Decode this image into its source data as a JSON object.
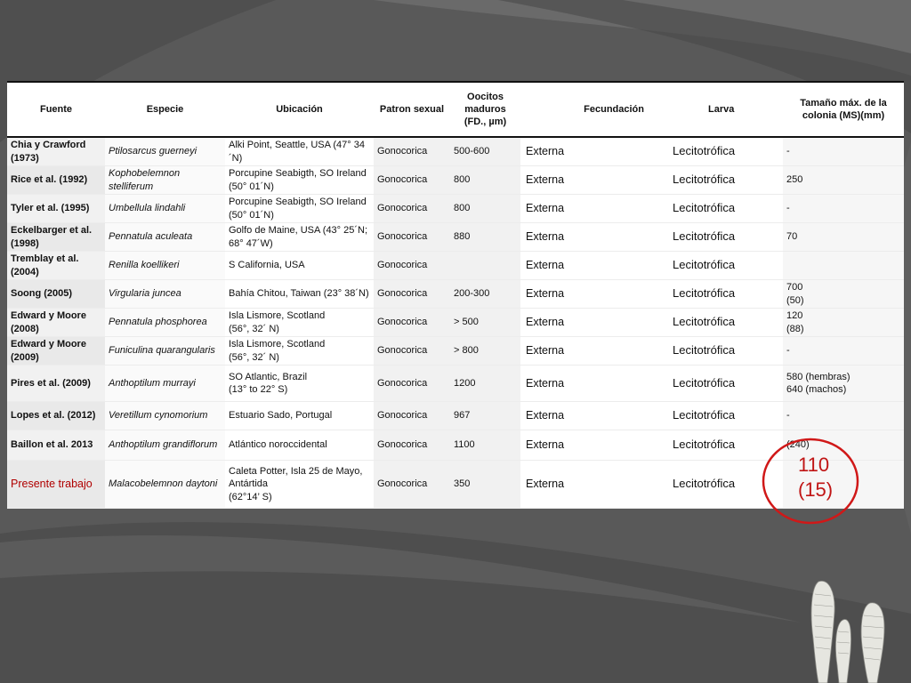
{
  "table": {
    "headers": {
      "fuente": "Fuente",
      "especie": "Especie",
      "ubicacion": "Ubicación",
      "patron": "Patron sexual",
      "oocitos": "Oocitos maduros (FD., µm)",
      "fecundacion": "Fecundación",
      "larva": "Larva",
      "tamano": "Tamaño máx. de la colonia (MS)(mm)"
    },
    "rows": [
      {
        "fuente": "Chia y Crawford (1973)",
        "especie": "Ptilosarcus guerneyi",
        "ubicacion": "Alki Point, Seattle, USA (47° 34´N)",
        "patron": "Gonocorica",
        "oocitos": "500-600",
        "fecundacion": "Externa",
        "larva": "Lecitotrófica",
        "tamano": "-"
      },
      {
        "fuente": "Rice et al. (1992)",
        "especie": "Kophobelemnon stelliferum",
        "ubicacion": "Porcupine Seabigth, SO Ireland (50° 01´N)",
        "patron": "Gonocorica",
        "oocitos": "800",
        "fecundacion": "Externa",
        "larva": "Lecitotrófica",
        "tamano": "250"
      },
      {
        "fuente": "Tyler et al. (1995)",
        "especie": "Umbellula lindahli",
        "ubicacion": "Porcupine Seabigth, SO Ireland (50° 01´N)",
        "patron": "Gonocorica",
        "oocitos": "800",
        "fecundacion": "Externa",
        "larva": "Lecitotrófica",
        "tamano": "-"
      },
      {
        "fuente": "Eckelbarger et al. (1998)",
        "especie": "Pennatula aculeata",
        "ubicacion": "Golfo de Maine, USA (43° 25´N; 68° 47´W)",
        "patron": "Gonocorica",
        "oocitos": "880",
        "fecundacion": "Externa",
        "larva": "Lecitotrófica",
        "tamano": "70"
      },
      {
        "fuente": "Tremblay et al. (2004)",
        "especie": "Renilla koellikeri",
        "ubicacion": "S California, USA",
        "patron": "Gonocorica",
        "oocitos": "",
        "fecundacion": "Externa",
        "larva": "Lecitotrófica",
        "tamano": ""
      },
      {
        "fuente": "Soong (2005)",
        "especie": "Virgularia juncea",
        "ubicacion": "Bahía Chitou, Taiwan (23° 38´N)",
        "patron": "Gonocorica",
        "oocitos": "200-300",
        "fecundacion": "Externa",
        "larva": "Lecitotrófica",
        "tamano": "700\n(50)"
      },
      {
        "fuente": "Edward y Moore (2008)",
        "especie": "Pennatula phosphorea",
        "ubicacion": "Isla Lismore, Scotland\n(56°, 32´ N)",
        "patron": "Gonocorica",
        "oocitos": "> 500",
        "fecundacion": "Externa",
        "larva": "Lecitotrófica",
        "tamano": "120\n(88)"
      },
      {
        "fuente": "Edward y Moore (2009)",
        "especie": "Funiculina quarangularis",
        "ubicacion": "Isla Lismore, Scotland\n(56°, 32´ N)",
        "patron": "Gonocorica",
        "oocitos": "> 800",
        "fecundacion": "Externa",
        "larva": "Lecitotrófica",
        "tamano": "-"
      },
      {
        "fuente": "Pires et al. (2009)",
        "especie": "Anthoptilum murrayi",
        "ubicacion": "SO Atlantic, Brazil\n(13° to 22° S)",
        "patron": "Gonocorica",
        "oocitos": "1200",
        "fecundacion": "Externa",
        "larva": "Lecitotrófica",
        "tamano": "580 (hembras)\n640 (machos)"
      },
      {
        "fuente": "Lopes et al. (2012)",
        "especie": "Veretillum cynomorium",
        "ubicacion": "Estuario Sado, Portugal",
        "patron": "Gonocorica",
        "oocitos": "967",
        "fecundacion": "Externa",
        "larva": "Lecitotrófica",
        "tamano": "-"
      },
      {
        "fuente": "Baillon et al. 2013",
        "especie": "Anthoptilum grandiflorum",
        "ubicacion": "Atlántico noroccidental",
        "patron": "Gonocorica",
        "oocitos": "1100",
        "fecundacion": "Externa",
        "larva": "Lecitotrófica",
        "tamano": "(240)"
      },
      {
        "fuente": "Presente trabajo",
        "especie": "Malacobelemnon daytoni",
        "ubicacion": "Caleta Potter, Isla 25 de Mayo, Antártida\n(62°14’ S)",
        "patron": "Gonocorica",
        "oocitos": "350",
        "fecundacion": "Externa",
        "larva": "Lecitotrófica",
        "tamano": ""
      }
    ]
  },
  "highlight": {
    "line1": "110",
    "line2": "(15)",
    "color": "#c01515"
  },
  "colors": {
    "background": "#5a5a5a",
    "highlight_red": "#d01818",
    "current_work_text": "#b00000"
  }
}
